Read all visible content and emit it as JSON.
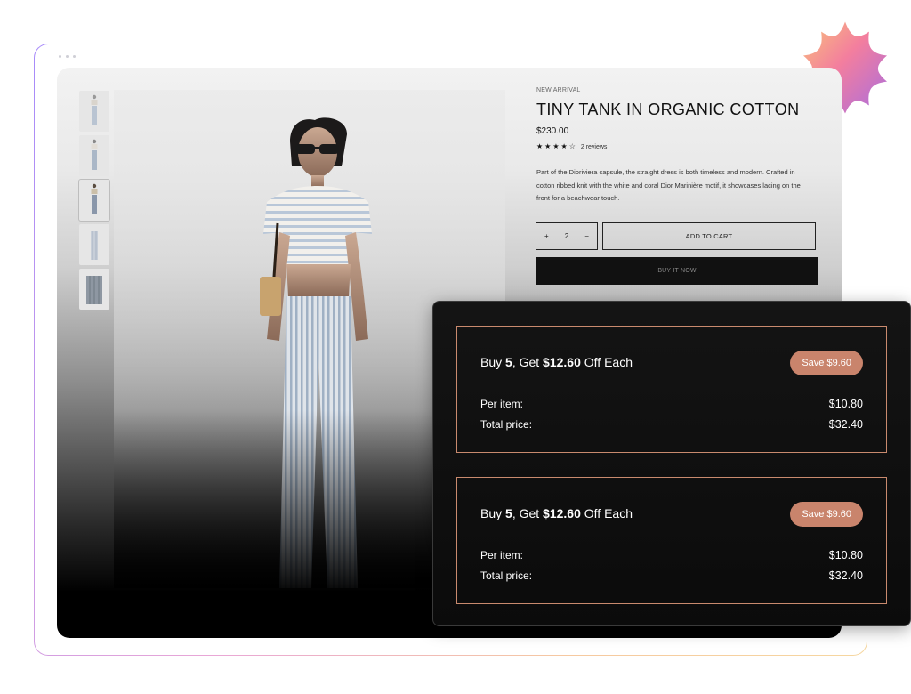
{
  "product": {
    "label": "NEW ARRIVAL",
    "title": "TINY TANK IN ORGANIC COTTON",
    "price": "$230.00",
    "rating": 4.5,
    "reviews": "2 reviews",
    "description": "Part of the Dioriviera capsule, the straight dress is both timeless and modern. Crafted in cotton ribbed knit with the white and coral Dior Marinière motif, it showcases lacing on the front for a beachwear touch."
  },
  "cart": {
    "plus": "+",
    "quantity": "2",
    "minus": "−",
    "add_to_cart": "ADD TO CART",
    "buy_now": "BUY IT NOW"
  },
  "offers": [
    {
      "prefix": "Buy ",
      "qty": "5",
      "mid": ", Get ",
      "amount": "$12.60",
      "suffix": " Off Each",
      "badge": "Save $9.60",
      "per_item_label": "Per item:",
      "per_item_value": "$10.80",
      "total_label": "Total price:",
      "total_value": "$32.40"
    },
    {
      "prefix": "Buy ",
      "qty": "5",
      "mid": ", Get ",
      "amount": "$12.60",
      "suffix": " Off Each",
      "badge": "Save $9.60",
      "per_item_label": "Per item:",
      "per_item_value": "$10.80",
      "total_label": "Total price:",
      "total_value": "$32.40"
    }
  ],
  "colors": {
    "accent": "#c9846c",
    "panel": "#0b0b0b",
    "offer_border": "#c98a6e"
  },
  "icons": [
    "star-icon",
    "plus-icon",
    "minus-icon",
    "starburst-decoration"
  ]
}
